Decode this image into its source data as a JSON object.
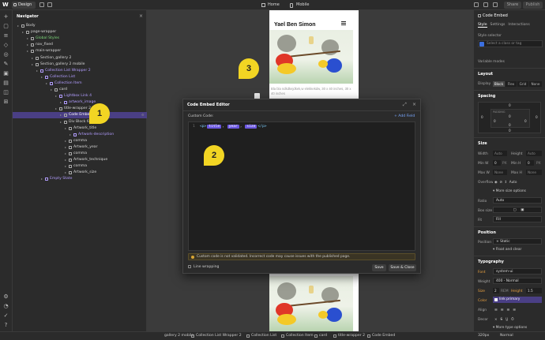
{
  "topbar": {
    "mode_label": "Design",
    "page_label": "Home",
    "breakpoint_label": "Mobile",
    "share_label": "Share",
    "publish_label": "Publish"
  },
  "navigator": {
    "title": "Navigator",
    "items": [
      {
        "label": "Body",
        "depth": 0
      },
      {
        "label": "page-wrapper",
        "depth": 1
      },
      {
        "label": "Global Styles",
        "depth": 2,
        "color": "green"
      },
      {
        "label": "nav_fixed",
        "depth": 2
      },
      {
        "label": "main-wrapper",
        "depth": 2
      },
      {
        "label": "Section_gallery 2",
        "depth": 3
      },
      {
        "label": "Section_gallery 2 mobile",
        "depth": 3
      },
      {
        "label": "Collection List Wrapper 2",
        "depth": 4,
        "color": "purple"
      },
      {
        "label": "Collection List",
        "depth": 5,
        "color": "purple"
      },
      {
        "label": "Collection Item",
        "depth": 6,
        "color": "purple"
      },
      {
        "label": "card",
        "depth": 7
      },
      {
        "label": "Lightbox Link 4",
        "depth": 8,
        "color": "purple"
      },
      {
        "label": "artwork_image",
        "depth": 9,
        "color": "purple"
      },
      {
        "label": "title-wrapper 2",
        "depth": 8
      },
      {
        "label": "Code Embed",
        "depth": 9,
        "selected": true
      },
      {
        "label": "Div Block 6",
        "depth": 9
      },
      {
        "label": "Artwork_title",
        "depth": 10
      },
      {
        "label": "Artwork-description",
        "depth": 11,
        "color": "purple"
      },
      {
        "label": "comma",
        "depth": 10
      },
      {
        "label": "Artwork_year",
        "depth": 10
      },
      {
        "label": "comma",
        "depth": 10
      },
      {
        "label": "Artwork_technique",
        "depth": 10
      },
      {
        "label": "comma",
        "depth": 10
      },
      {
        "label": "Artwork_size",
        "depth": 10
      },
      {
        "label": "Empty State",
        "depth": 5,
        "color": "purple"
      }
    ]
  },
  "canvas": {
    "site_title": "Yael Ben Simon",
    "caption": "Bla bla ndkdkejdkek,w elekkekdw, 30 x 40 inches, 30 x 40 inches"
  },
  "markers": {
    "m1": "1",
    "m2": "2",
    "m3": "3"
  },
  "modal": {
    "title": "Code Embed Editor",
    "custom_code_label": "Custom Code:",
    "add_field_label": "+ Add Field",
    "line_number": "1",
    "code": {
      "open_tag": "<p>",
      "field1": "title",
      "sep1": ", ",
      "field2": "year",
      "sep2": ", ",
      "field3": "size",
      "close_tag": "</p>"
    },
    "warning": "Custom code is not validated. Incorrect code may cause issues with the published page.",
    "line_wrapping_label": "Line wrapping",
    "save_label": "Save",
    "save_close_label": "Save & Close"
  },
  "right_panel": {
    "element_name": "Code Embed",
    "tabs": [
      "Style",
      "Settings",
      "Interactions"
    ],
    "selector_label": "Style selector",
    "selector_placeholder": "Select a class or tag",
    "variable_modes": "Variable modes",
    "layout": {
      "title": "Layout",
      "display_label": "Display",
      "options": [
        "Block",
        "Flex",
        "Grid",
        "None"
      ]
    },
    "spacing": {
      "title": "Spacing",
      "padding_label": "PADDING",
      "margin": "0",
      "padding": "0"
    },
    "size": {
      "title": "Size",
      "width_label": "Width",
      "width_val": "Auto",
      "height_label": "Height",
      "height_val": "Auto",
      "minw_label": "Min W",
      "minw_val": "0",
      "minh_label": "Min H",
      "minh_val": "0",
      "maxw_label": "Max W",
      "maxw_val": "None",
      "maxh_label": "Max H",
      "maxh_val": "None",
      "px": "PX",
      "overflow_label": "Overflow",
      "overflow_val": "Auto",
      "more_label": "More size options",
      "ratio_label": "Ratio",
      "ratio_val": "Auto",
      "boxsize_label": "Box size",
      "fit_label": "Fit",
      "fit_val": "Fill"
    },
    "position": {
      "title": "Position",
      "label": "Position",
      "value": "Static",
      "float_label": "Float and clear"
    },
    "typography": {
      "title": "Typography",
      "font_label": "Font",
      "font_val": "system-ui",
      "weight_label": "Weight",
      "weight_val": "400 - Normal",
      "size_label": "Size",
      "size_val": "2",
      "size_unit": "REM",
      "height_label": "Height",
      "height_val": "1.5",
      "color_label": "Color",
      "color_val": "link primary",
      "align_label": "Align",
      "decor_label": "Decor",
      "more_label": "More type options"
    }
  },
  "bottombar": {
    "crumbs": [
      "gallery 2 mobile",
      "Collection List Wrapper 2",
      "Collection List",
      "Collection Item",
      "card",
      "title-wrapper 2",
      "Code Embed"
    ],
    "zoom": "320px",
    "normal": "Normal"
  },
  "colors": {
    "accent_purple": "#6b57e0",
    "selected_row": "#4a3f85",
    "marker_yellow": "#f2d523"
  }
}
